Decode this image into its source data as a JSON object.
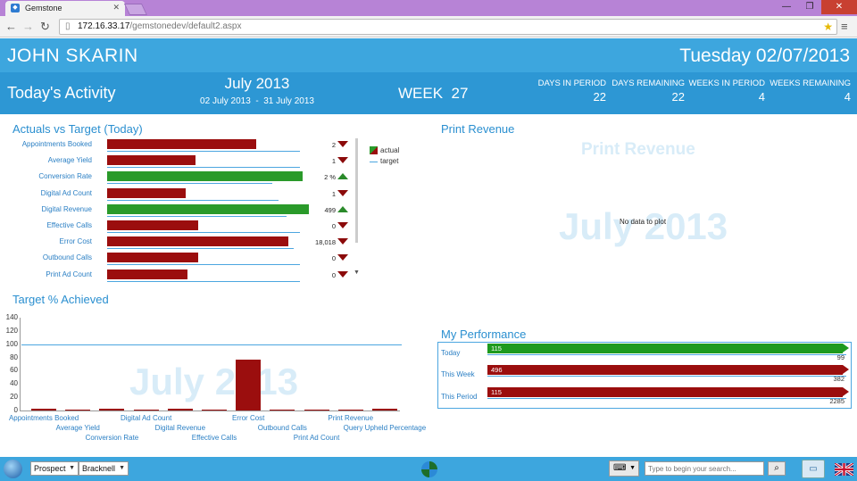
{
  "browser": {
    "tab_title": "Gemstone",
    "url_host": "172.16.33.17",
    "url_path": "/gemstonedev/default2.aspx"
  },
  "header": {
    "user_name": "JOHN SKARIN",
    "date": "Tuesday 02/07/2013",
    "today_label": "Today's Activity",
    "month": "July 2013",
    "start_date": "02 July 2013",
    "range_sep": "-",
    "end_date": "31 July 2013",
    "week_label": "WEEK",
    "week_number": "27",
    "stats": [
      {
        "label": "DAYS IN PERIOD",
        "value": "22"
      },
      {
        "label": "DAYS REMAINING",
        "value": "22"
      },
      {
        "label": "WEEKS IN PERIOD",
        "value": "4"
      },
      {
        "label": "WEEKS REMAINING",
        "value": "4"
      }
    ]
  },
  "actuals": {
    "title": "Actuals vs Target (Today)",
    "legend_actual": "actual",
    "legend_target": "target",
    "rows": [
      {
        "label": "Appointments Booked",
        "value": "2",
        "trend": "down",
        "actual": 0.74,
        "target": 0.99,
        "color": "#9b0e0e"
      },
      {
        "label": "Average Yield",
        "value": "1",
        "trend": "down",
        "actual": 0.44,
        "target": 0.99,
        "color": "#9b0e0e"
      },
      {
        "label": "Conversion Rate",
        "value": "2 %",
        "trend": "up",
        "actual": 0.97,
        "target": 0.85,
        "color": "#2a9a2a"
      },
      {
        "label": "Digital Ad Count",
        "value": "1",
        "trend": "down",
        "actual": 0.39,
        "target": 0.88,
        "color": "#9b0e0e"
      },
      {
        "label": "Digital Revenue",
        "value": "499",
        "trend": "up",
        "actual": 1.0,
        "target": 0.92,
        "color": "#2a9a2a"
      },
      {
        "label": "Effective Calls",
        "value": "0",
        "trend": "down",
        "actual": 0.45,
        "target": 0.99,
        "color": "#9b0e0e"
      },
      {
        "label": "Error Cost",
        "value": "18,018",
        "trend": "down",
        "actual": 0.9,
        "target": 0.96,
        "color": "#9b0e0e"
      },
      {
        "label": "Outbound Calls",
        "value": "0",
        "trend": "down",
        "actual": 0.45,
        "target": 0.99,
        "color": "#9b0e0e"
      },
      {
        "label": "Print Ad Count",
        "value": "0",
        "trend": "down",
        "actual": 0.4,
        "target": 0.99,
        "color": "#9b0e0e"
      }
    ]
  },
  "print_revenue": {
    "title": "Print Revenue",
    "chart_title": "Print Revenue",
    "watermark": "July 2013",
    "no_data": "No data to plot"
  },
  "target_achieved": {
    "title": "Target % Achieved",
    "watermark": "July 2013"
  },
  "chart_data": {
    "type": "bar",
    "categories": [
      "Appointments Booked",
      "Average Yield",
      "Conversion Rate",
      "Digital Ad Count",
      "Digital Revenue",
      "Effective Calls",
      "Error Cost",
      "Outbound Calls",
      "Print Ad Count",
      "Print Revenue",
      "Query Upheld Percentage"
    ],
    "values": [
      3,
      1,
      3,
      2,
      3,
      1,
      77,
      1,
      1,
      2,
      3
    ],
    "ylim": [
      0,
      140
    ],
    "yticks": [
      "0",
      "20",
      "40",
      "60",
      "80",
      "100",
      "120",
      "140"
    ],
    "reference_line": 100,
    "grid": false
  },
  "performance": {
    "title": "My Performance",
    "rows": [
      {
        "label": "Today",
        "value": "115",
        "target": "99",
        "color": "#1e9a1e"
      },
      {
        "label": "This Week",
        "value": "496",
        "target": "382",
        "color": "#9b0e0e"
      },
      {
        "label": "This Period",
        "value": "115",
        "target": "2285",
        "color": "#9b0e0e"
      }
    ]
  },
  "bottombar": {
    "select1": "Prospect",
    "select2": "Bracknell",
    "search_placeholder": "Type to begin your search..."
  }
}
